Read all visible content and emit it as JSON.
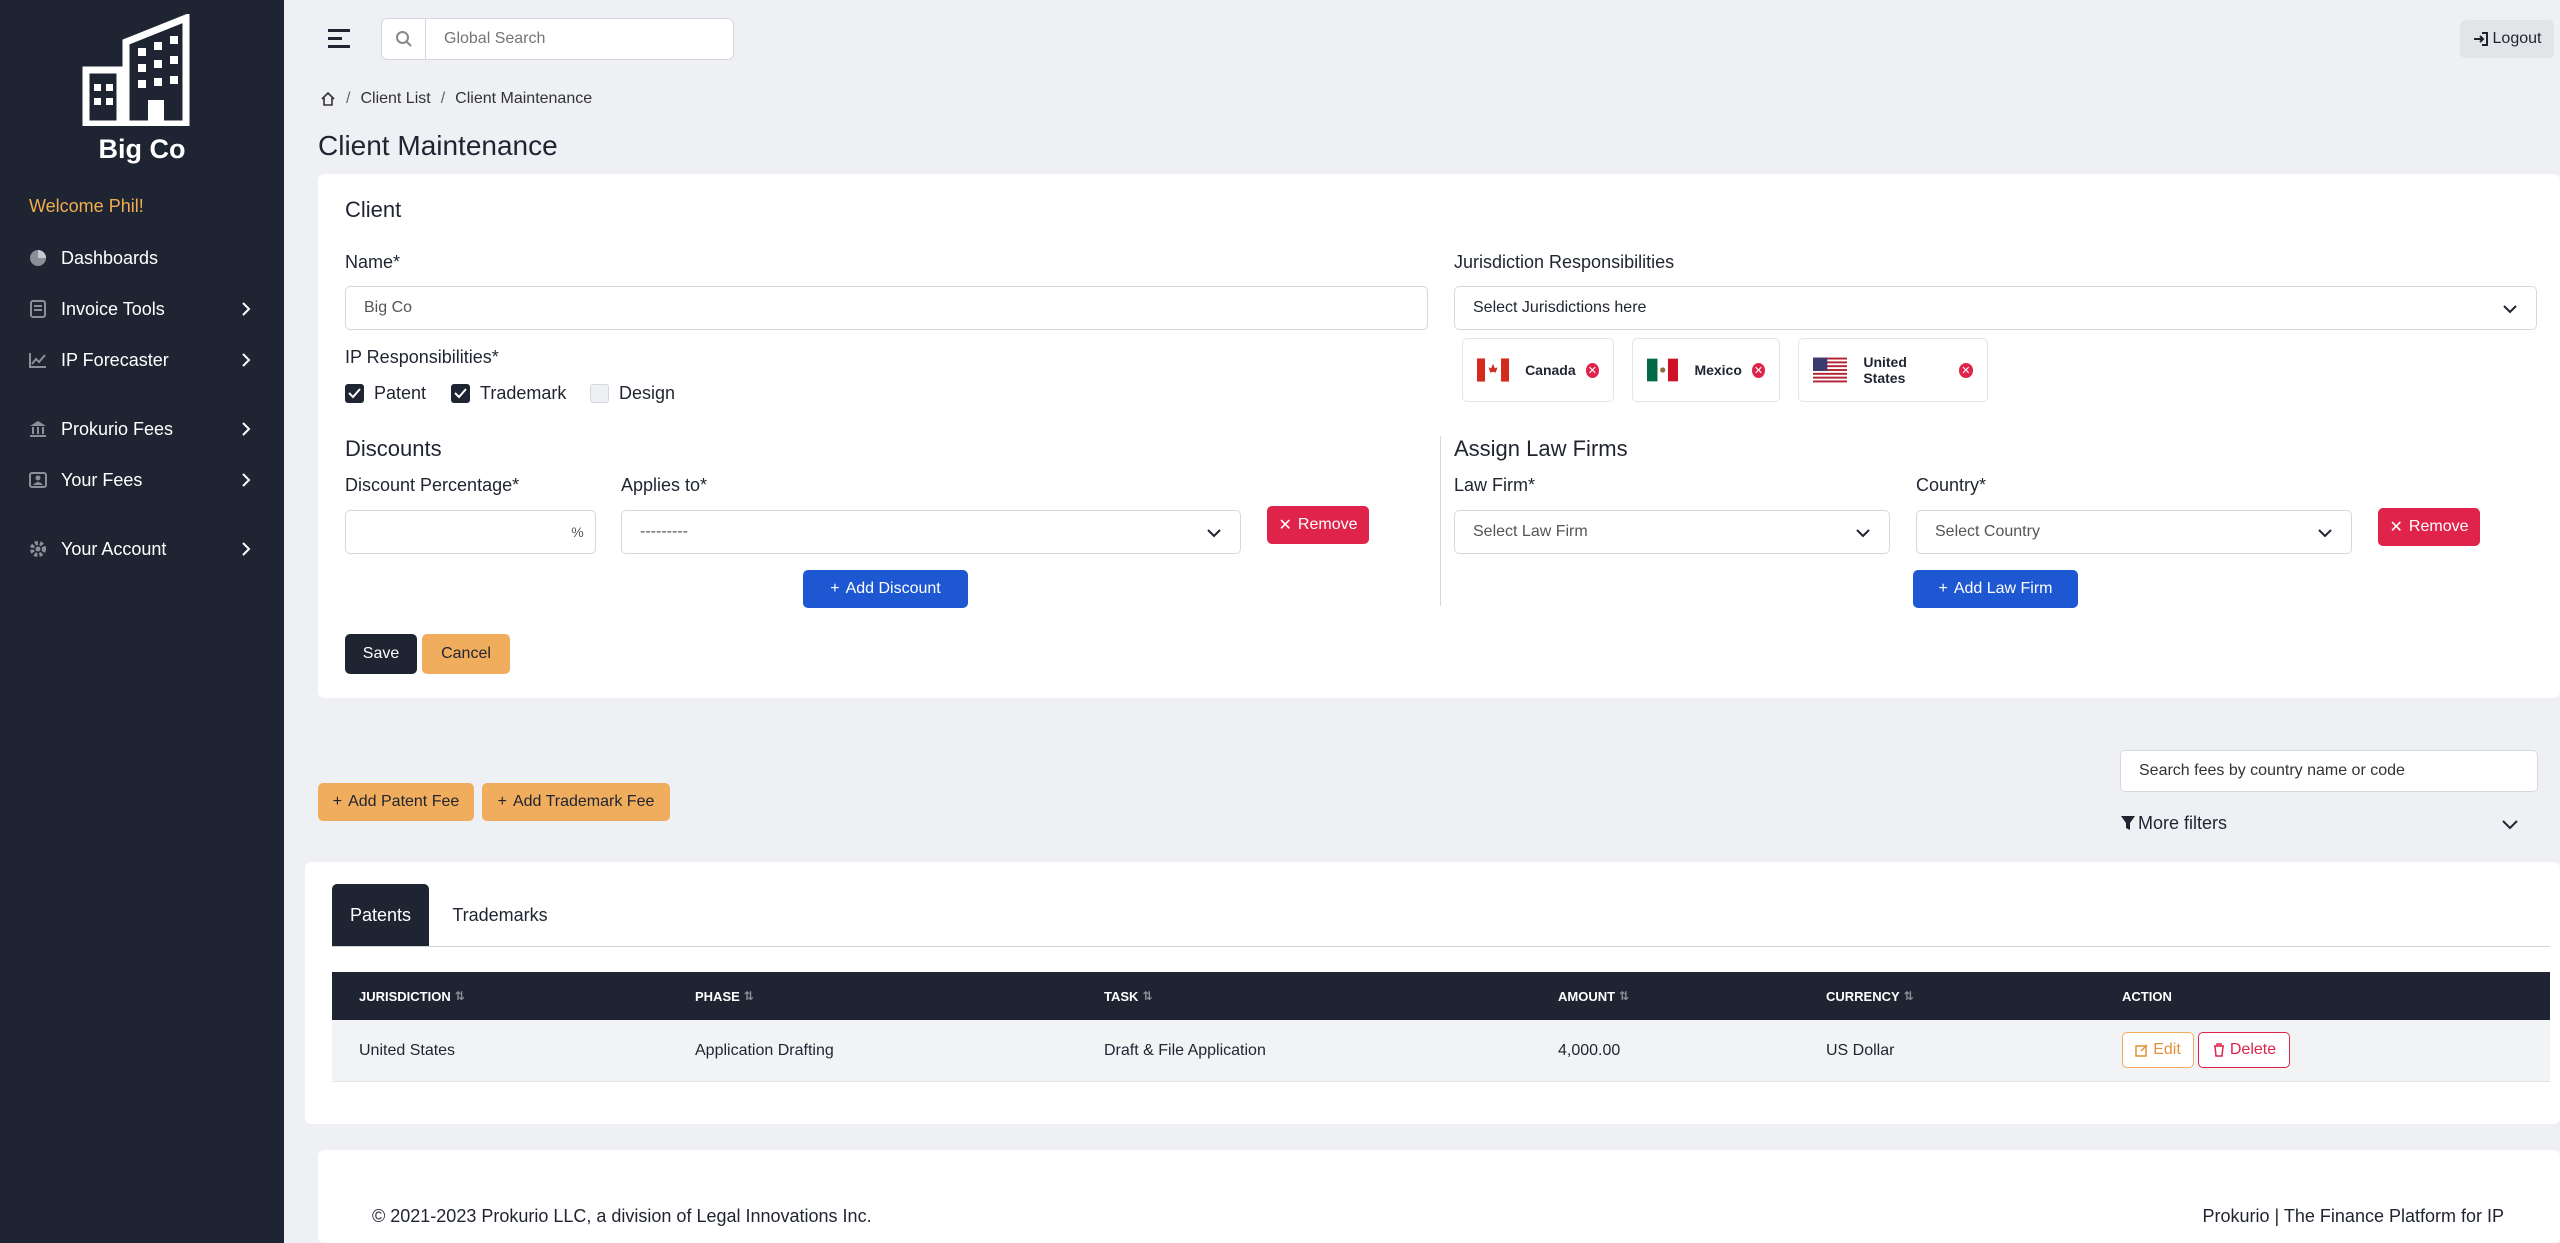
{
  "sidebar": {
    "brand": "Big Co",
    "welcome": "Welcome Phil!",
    "items": [
      {
        "label": "Dashboards",
        "icon": "pie-chart-icon"
      },
      {
        "label": "Invoice Tools",
        "icon": "invoice-icon"
      },
      {
        "label": "IP Forecaster",
        "icon": "line-chart-icon"
      },
      {
        "label": "Prokurio Fees",
        "icon": "bank-icon"
      },
      {
        "label": "Your Fees",
        "icon": "fees-icon"
      },
      {
        "label": "Your Account",
        "icon": "gear-icon"
      }
    ]
  },
  "topbar": {
    "search_placeholder": "Global Search",
    "logout_label": "Logout"
  },
  "breadcrumb": [
    "Client List",
    "Client Maintenance"
  ],
  "page_title": "Client Maintenance",
  "client": {
    "section_title": "Client",
    "name_label": "Name*",
    "name_value": "Big Co",
    "ip_label": "IP Responsibilities*",
    "ip_options": [
      {
        "label": "Patent",
        "checked": true
      },
      {
        "label": "Trademark",
        "checked": true
      },
      {
        "label": "Design",
        "checked": false
      }
    ],
    "jurisdiction_label": "Jurisdiction Responsibilities",
    "jurisdiction_placeholder": "Select Jurisdictions here",
    "jurisdictions": [
      "Canada",
      "Mexico",
      "United States"
    ]
  },
  "discounts": {
    "title": "Discounts",
    "pct_label": "Discount Percentage*",
    "pct_addon": "%",
    "applies_label": "Applies to*",
    "applies_value": "---------",
    "remove_label": "Remove",
    "add_label": "Add Discount"
  },
  "law_firms": {
    "title": "Assign Law Firms",
    "firm_label": "Law Firm*",
    "firm_placeholder": "Select Law Firm",
    "country_label": "Country*",
    "country_placeholder": "Select Country",
    "remove_label": "Remove",
    "add_label": "Add Law Firm"
  },
  "form_actions": {
    "save": "Save",
    "cancel": "Cancel"
  },
  "fees": {
    "add_patent": "Add Patent Fee",
    "add_trademark": "Add Trademark Fee",
    "search_placeholder": "Search fees by country name or code",
    "more_filters": "More filters",
    "tabs": [
      "Patents",
      "Trademarks"
    ],
    "columns": [
      "JURISDICTION",
      "PHASE",
      "TASK",
      "AMOUNT",
      "CURRENCY",
      "ACTION"
    ],
    "rows": [
      {
        "jurisdiction": "United States",
        "phase": "Application Drafting",
        "task": "Draft & File Application",
        "amount": "4,000.00",
        "currency": "US Dollar"
      }
    ],
    "edit_label": "Edit",
    "delete_label": "Delete"
  },
  "footer": {
    "copyright": "© 2021-2023 Prokurio LLC, a division of Legal Innovations Inc.",
    "tagline": "Prokurio | The Finance Platform for IP"
  },
  "colors": {
    "sidebar_bg": "#1f2432",
    "accent_orange": "#f0ad5e",
    "danger": "#e0234b",
    "primary": "#1e57d2"
  }
}
